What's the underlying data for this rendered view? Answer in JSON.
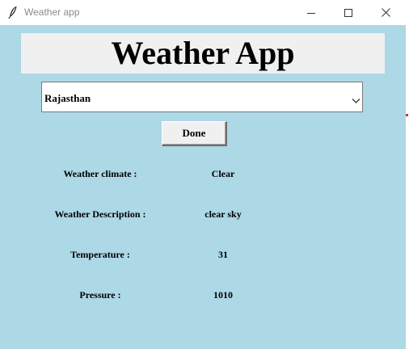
{
  "window": {
    "title": "Weather app"
  },
  "header": {
    "title": "Weather App"
  },
  "location_select": {
    "selected": "Rajasthan"
  },
  "done_button": {
    "label": "Done"
  },
  "details": [
    {
      "label": "Weather climate :",
      "value": "Clear"
    },
    {
      "label": "Weather Description :",
      "value": "clear sky"
    },
    {
      "label": "Temperature :",
      "value": "31"
    },
    {
      "label": "Pressure :",
      "value": "1010"
    }
  ],
  "colors": {
    "client_background": "#add8e6",
    "header_background": "#f0f0f0",
    "title_text": "#8a8a8a"
  },
  "icons": {
    "app": "feather-icon",
    "minimize": "minimize-icon",
    "maximize": "maximize-icon",
    "close": "close-icon",
    "dropdown": "chevron-down-icon"
  }
}
